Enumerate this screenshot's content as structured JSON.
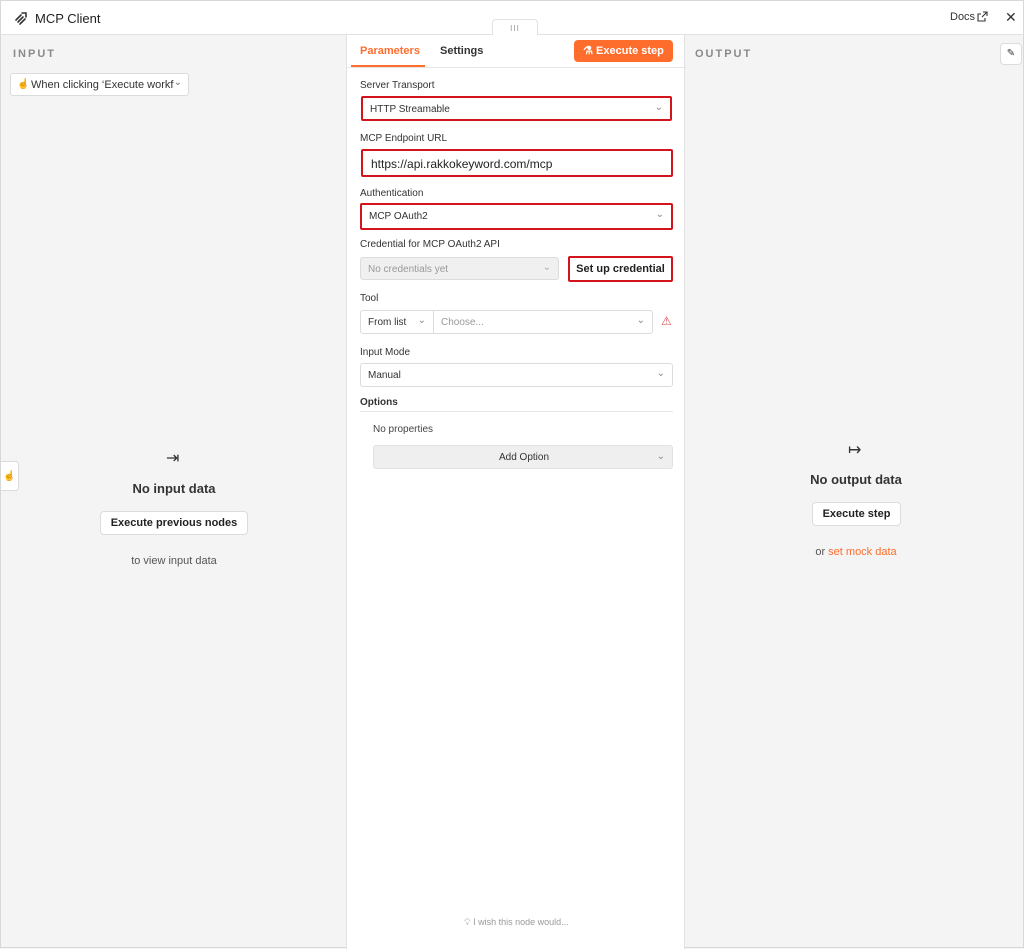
{
  "window": {
    "title": "MCP Client",
    "docs_label": "Docs"
  },
  "drag_handle": "III",
  "input_panel": {
    "label": "INPUT",
    "trigger_select": "When clicking ‘Execute workflow’",
    "empty_title": "No input data",
    "execute_previous_label": "Execute previous nodes",
    "hint": "to view input data"
  },
  "params": {
    "tabs": [
      {
        "label": "Parameters",
        "active": true
      },
      {
        "label": "Settings",
        "active": false
      }
    ],
    "execute_step_label": "Execute step",
    "server_transport": {
      "label": "Server Transport",
      "value": "HTTP Streamable"
    },
    "endpoint": {
      "label": "MCP Endpoint URL",
      "value": "https://api.rakkokeyword.com/mcp"
    },
    "authentication": {
      "label": "Authentication",
      "value": "MCP OAuth2"
    },
    "credential": {
      "label": "Credential for MCP OAuth2 API",
      "placeholder": "No credentials yet",
      "setup_label": "Set up credential"
    },
    "tool": {
      "label": "Tool",
      "mode": "From list",
      "placeholder": "Choose..."
    },
    "input_mode": {
      "label": "Input Mode",
      "value": "Manual"
    },
    "options": {
      "title": "Options",
      "empty": "No properties",
      "add_label": "Add Option"
    },
    "wish": "I wish this node would..."
  },
  "output_panel": {
    "label": "OUTPUT",
    "empty_title": "No output data",
    "execute_label": "Execute step",
    "or_text": "or",
    "mock_link": "set mock data"
  },
  "colors": {
    "accent": "#ff6d2d",
    "highlight": "#d4141c",
    "warning": "#e5484d"
  },
  "icons": [
    "n8n-logo-icon",
    "external-link-icon",
    "close-icon",
    "trigger-icon",
    "flask-icon",
    "chevron-down-icon",
    "warning-icon",
    "lightbulb-icon",
    "arrow-to-right-icon",
    "arrow-right-icon",
    "pencil-icon",
    "cursor-icon"
  ]
}
